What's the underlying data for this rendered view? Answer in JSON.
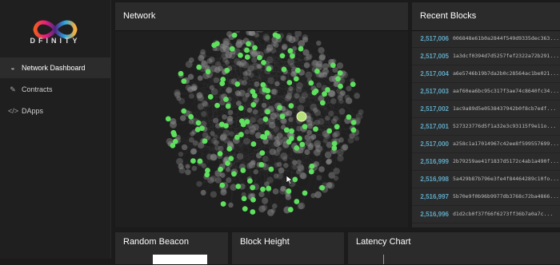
{
  "brand": {
    "name": "DFINITY",
    "colors": [
      "#29abe2",
      "#522785",
      "#ed1e79",
      "#f15a24",
      "#fbb03b"
    ]
  },
  "sidebar": {
    "items": [
      {
        "label": "Network Dashboard",
        "icon": "dashboard-icon",
        "active": true
      },
      {
        "label": "Contracts",
        "icon": "wrench-icon",
        "active": false
      },
      {
        "label": "DApps",
        "icon": "code-icon",
        "active": false
      }
    ]
  },
  "network": {
    "title": "Network"
  },
  "recent_blocks": {
    "title": "Recent Blocks",
    "items": [
      {
        "number": "2,517,006",
        "hash": "006848e61b0a2844f549d9335dec363..."
      },
      {
        "number": "2,517,005",
        "hash": "1a3dcf0394d7d5257fef2322a72b291..."
      },
      {
        "number": "2,517,004",
        "hash": "a6e5746b19b7da2b0c28564ac1be021..."
      },
      {
        "number": "2,517,003",
        "hash": "aaf60ea6bc95c317f3ae74c8640fc34..."
      },
      {
        "number": "2,517,002",
        "hash": "1ac9a89d5e0538437942b0f8cb7edf..."
      },
      {
        "number": "2,517,001",
        "hash": "527323776d5f1a32e3c93115f9e11o..."
      },
      {
        "number": "2,517,000",
        "hash": "a258c1a17014967c42ee8f599557699..."
      },
      {
        "number": "2,516,999",
        "hash": "2b79259ae41f1837d5172c4ab1a490f..."
      },
      {
        "number": "2,516,998",
        "hash": "5a429b87b796e3fe4f84464289c10fo..."
      },
      {
        "number": "2,516,997",
        "hash": "5b70e9f0b96b9977db3768c72ba4866..."
      },
      {
        "number": "2,516,996",
        "hash": "d1d2cb0f37f66f6273ff36b7a0a7c..."
      }
    ]
  },
  "bottom_panels": {
    "random_beacon": {
      "title": "Random Beacon"
    },
    "block_height": {
      "title": "Block Height"
    },
    "latency_chart": {
      "title": "Latency Chart"
    }
  }
}
